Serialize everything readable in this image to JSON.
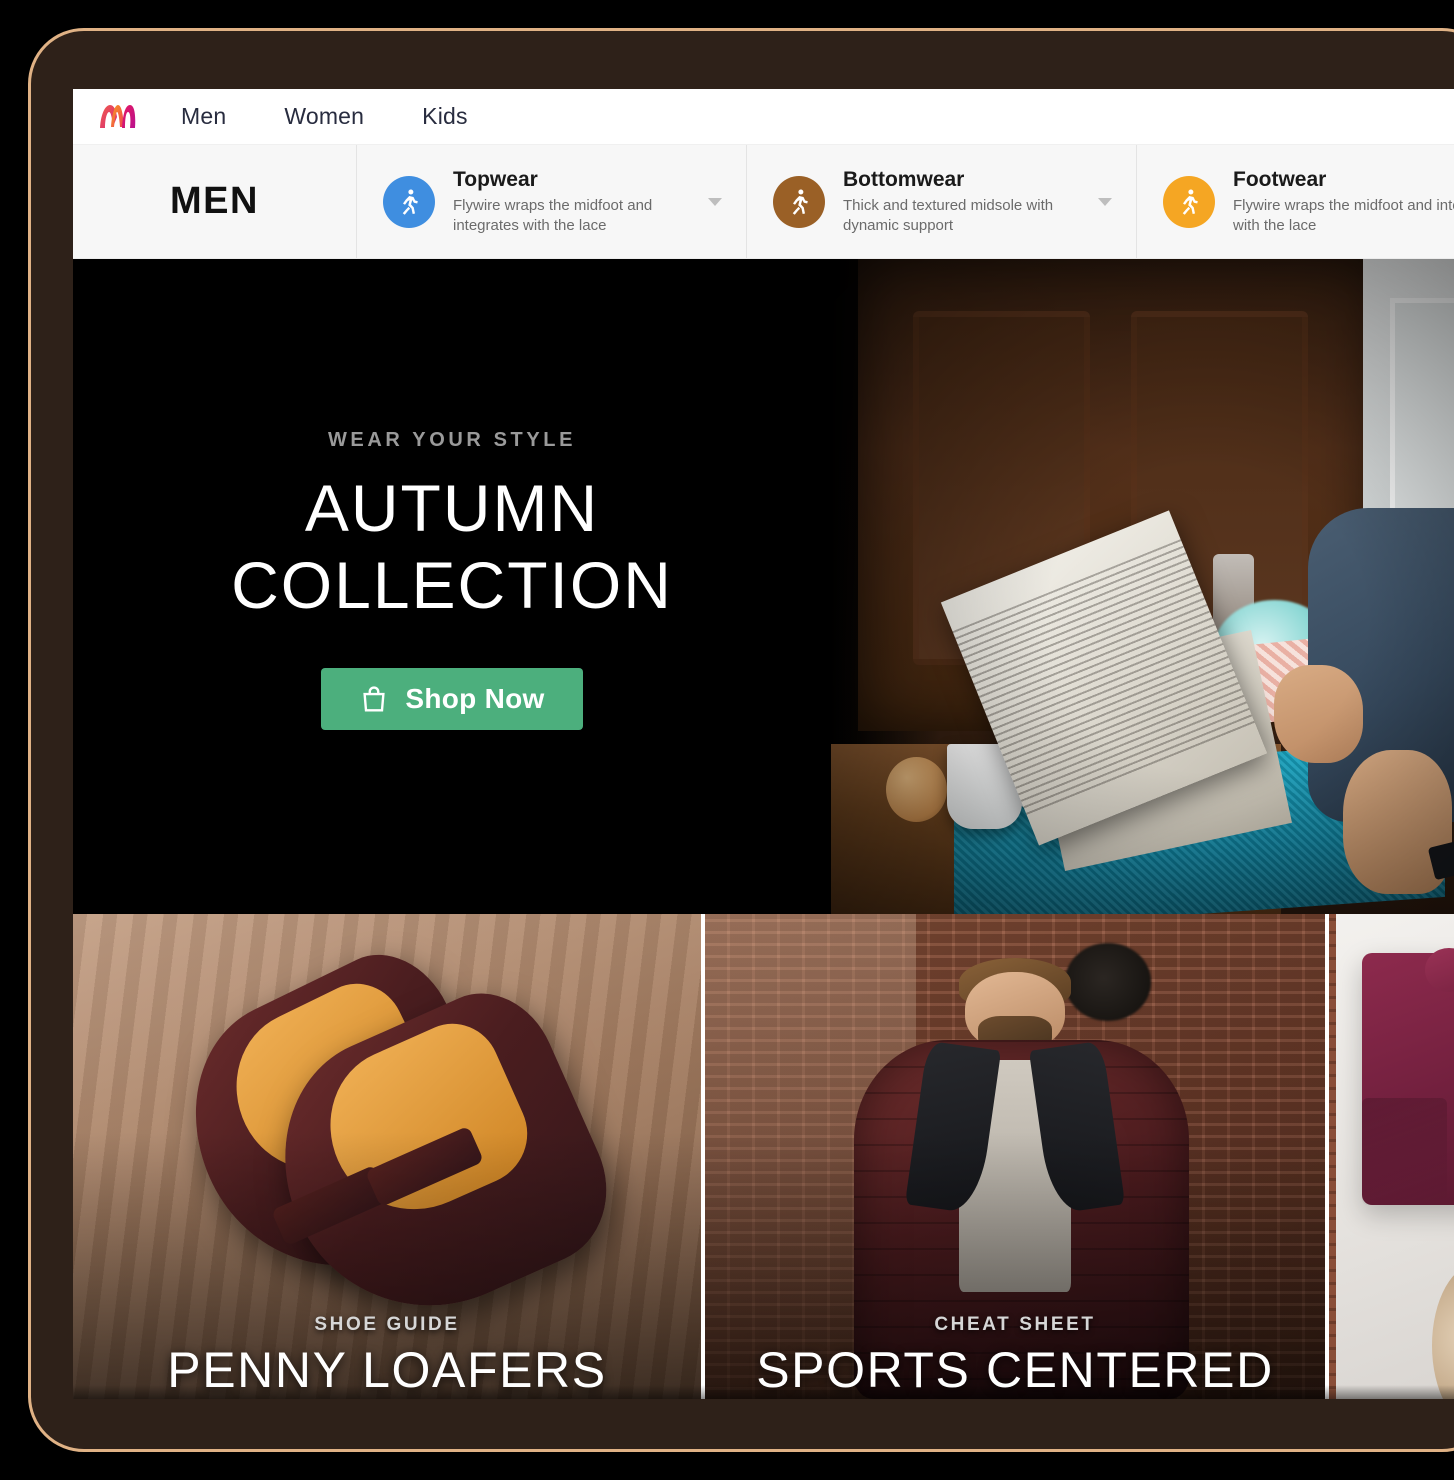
{
  "nav": {
    "logo_icon": "myntra-m-logo",
    "links": [
      {
        "label": "Men"
      },
      {
        "label": "Women"
      },
      {
        "label": "Kids"
      }
    ]
  },
  "category_bar": {
    "title": "MEN",
    "cards": [
      {
        "name": "Topwear",
        "description": "Flywire wraps the midfoot and integrates with the lace",
        "icon": "walking-person-icon",
        "icon_color": "#3f8ee0",
        "chevron_icon": "chevron-down-icon"
      },
      {
        "name": "Bottomwear",
        "description": "Thick and textured midsole with dynamic support",
        "icon": "walking-person-icon",
        "icon_color": "#9a6026",
        "chevron_icon": "chevron-down-icon"
      },
      {
        "name": "Footwear",
        "description": "Flywire wraps the midfoot and integrates with the lace",
        "icon": "walking-person-icon",
        "icon_color": "#f5a623",
        "chevron_icon": "chevron-down-icon"
      }
    ]
  },
  "hero": {
    "eyebrow": "WEAR YOUR STYLE",
    "title_line1": "AUTUMN",
    "title_line2": "COLLECTION",
    "cta_label": "Shop Now",
    "cta_icon": "shopping-bag-icon",
    "cta_color": "#4caf7d",
    "background_color": "#000000",
    "photo_alt": "person-reading-newspaper-photo"
  },
  "promo_cards": [
    {
      "eyebrow": "SHOE GUIDE",
      "title": "PENNY LOAFERS",
      "image_alt": "burgundy-penny-loafers-photo"
    },
    {
      "eyebrow": "CHEAT SHEET",
      "title": "SPORTS CENTERED",
      "image_alt": "man-in-burgundy-puffer-jacket-photo"
    },
    {
      "eyebrow": "",
      "title": "",
      "image_alt": "folded-burgundy-sweater-flatlay-photo"
    }
  ],
  "frame": {
    "body_color": "#2e2119",
    "edge_color": "#e0b285"
  }
}
